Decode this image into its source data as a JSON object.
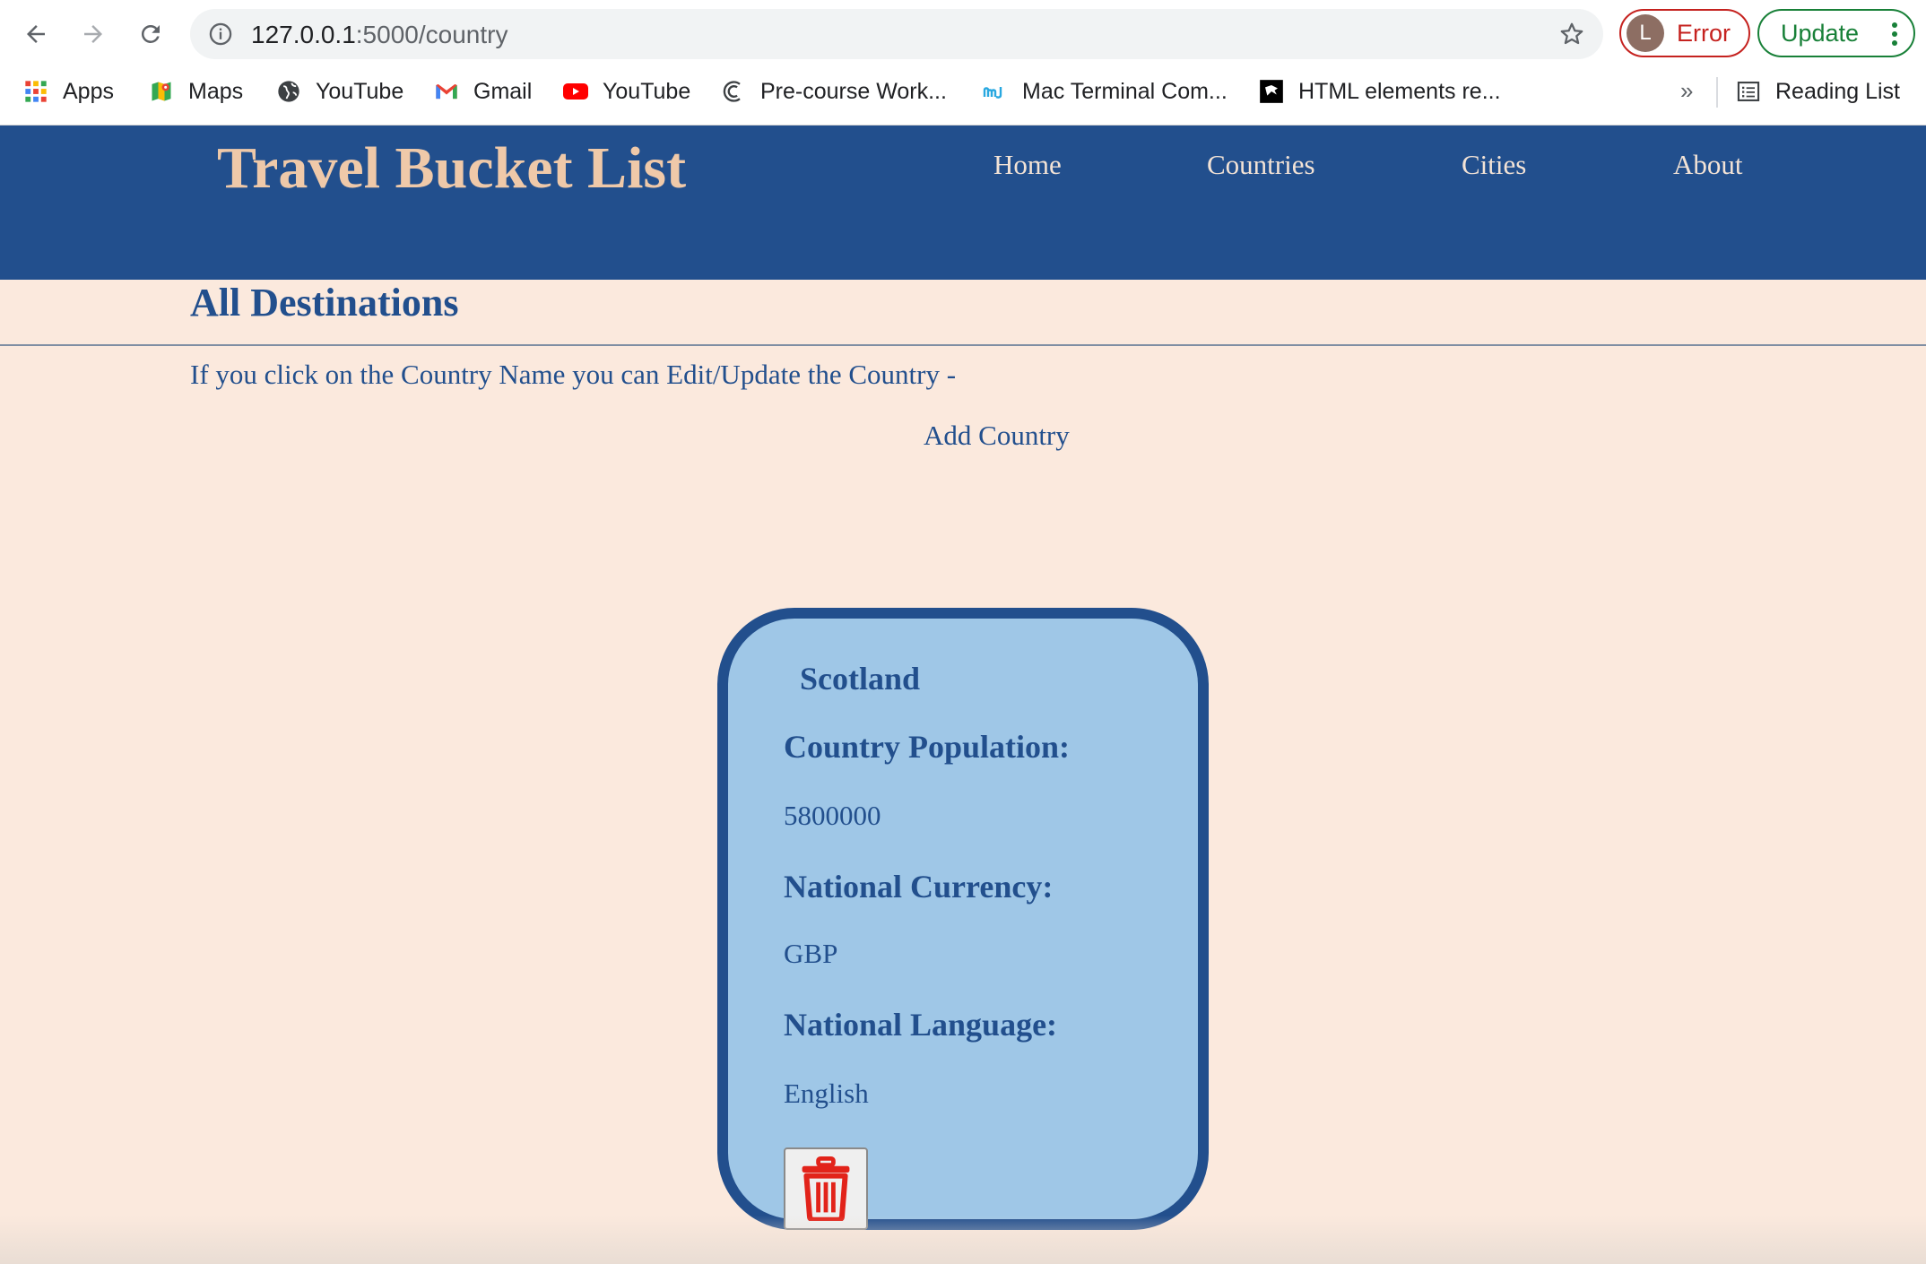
{
  "browser": {
    "url_host": "127.0.0.1",
    "url_path": ":5000/country",
    "profile_initial": "L",
    "profile_status": "Error",
    "update_label": "Update",
    "bookmarks": [
      {
        "label": "Apps",
        "icon": "apps-grid-icon"
      },
      {
        "label": "Maps",
        "icon": "maps-icon"
      },
      {
        "label": "YouTube",
        "icon": "globe-icon"
      },
      {
        "label": "Gmail",
        "icon": "gmail-icon"
      },
      {
        "label": "YouTube",
        "icon": "youtube-icon"
      },
      {
        "label": "Pre-course Work...",
        "icon": "codeclan-icon"
      },
      {
        "label": "Mac Terminal Com...",
        "icon": "mj-icon"
      },
      {
        "label": "HTML elements re...",
        "icon": "mdn-icon"
      }
    ],
    "overflow_label": "»",
    "reading_list_label": "Reading List"
  },
  "site": {
    "brand": "Travel Bucket List",
    "nav": [
      "Home",
      "Countries",
      "Cities",
      "About"
    ]
  },
  "page": {
    "title": "All Destinations",
    "hint": "If you click on the Country Name you can Edit/Update the Country -",
    "add_link": "Add Country"
  },
  "country": {
    "name": "Scotland",
    "population_label": "Country Population:",
    "population": "5800000",
    "currency_label": "National Currency:",
    "currency": "GBP",
    "language_label": "National Language:",
    "language": "English",
    "delete_icon": "trash-icon",
    "delete_color": "#e2231a"
  },
  "colors": {
    "header_bg": "#224f8d",
    "brand": "#efc9a9",
    "page_bg": "#fbe9dd",
    "card_bg": "#9fc7e7"
  }
}
